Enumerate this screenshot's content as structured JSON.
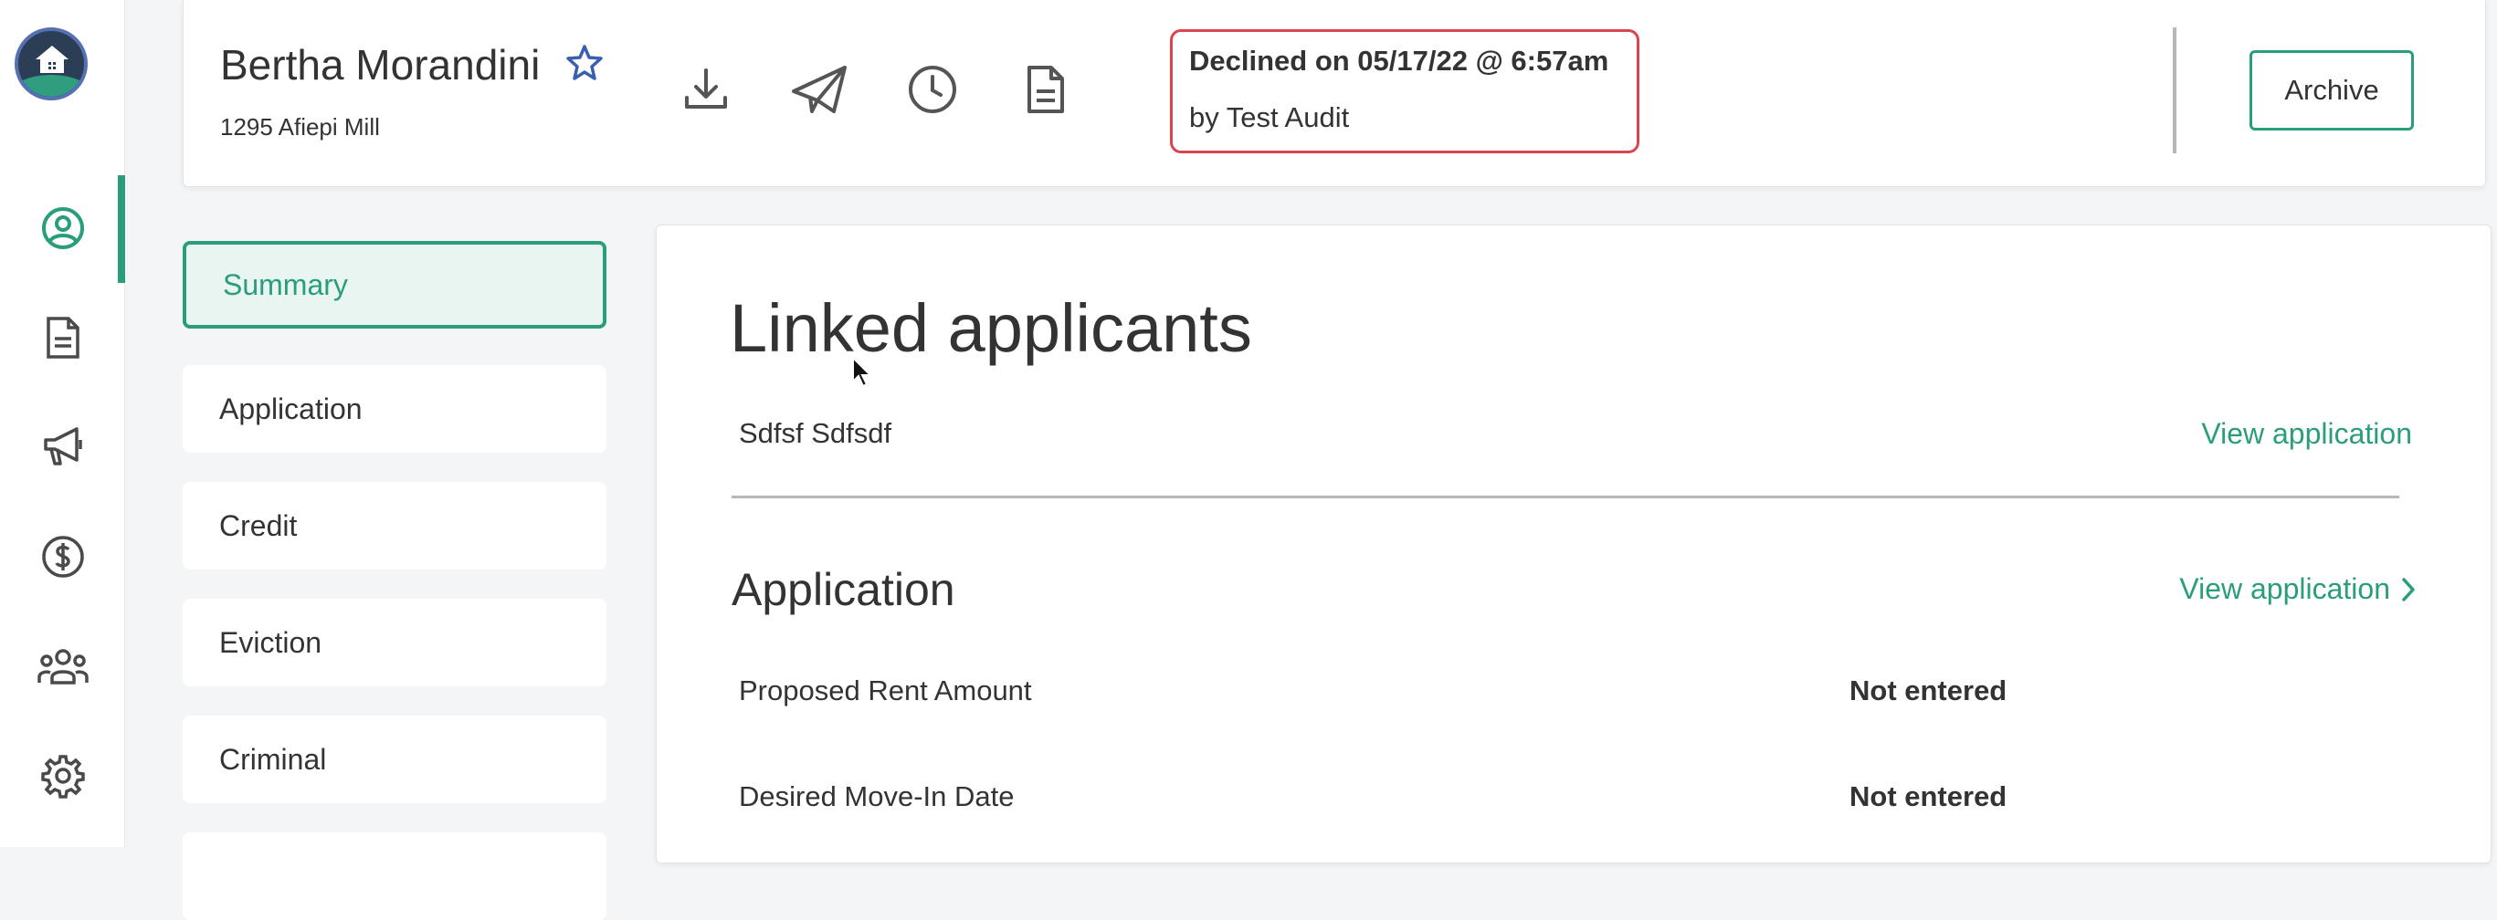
{
  "header": {
    "name": "Bertha Morandini",
    "address": "1295 Afiepi Mill",
    "status_line1": "Declined on 05/17/22 @ 6:57am",
    "status_line2": "by Test Audit",
    "archive_label": "Archive",
    "icons": [
      "download-icon",
      "send-icon",
      "clock-icon",
      "document-icon"
    ]
  },
  "rail": {
    "items": [
      "user-circle-icon",
      "document-icon",
      "megaphone-icon",
      "dollar-icon",
      "people-icon",
      "gear-icon"
    ],
    "active": "user-circle-icon"
  },
  "sidenav": {
    "items": [
      {
        "label": "Summary",
        "active": true
      },
      {
        "label": "Application",
        "active": false
      },
      {
        "label": "Credit",
        "active": false
      },
      {
        "label": "Eviction",
        "active": false
      },
      {
        "label": "Criminal",
        "active": false
      }
    ]
  },
  "main": {
    "linked_title": "Linked applicants",
    "applicants": [
      {
        "name": "Sdfsf Sdfsdf",
        "link": "View application"
      }
    ],
    "application_title": "Application",
    "application_link": "View application",
    "fields": [
      {
        "label": "Proposed Rent Amount",
        "value": "Not entered"
      },
      {
        "label": "Desired Move-In Date",
        "value": "Not entered"
      }
    ]
  },
  "colors": {
    "accent": "#2a9d7c",
    "declined": "#d9444f",
    "star": "#3a5fb0"
  }
}
